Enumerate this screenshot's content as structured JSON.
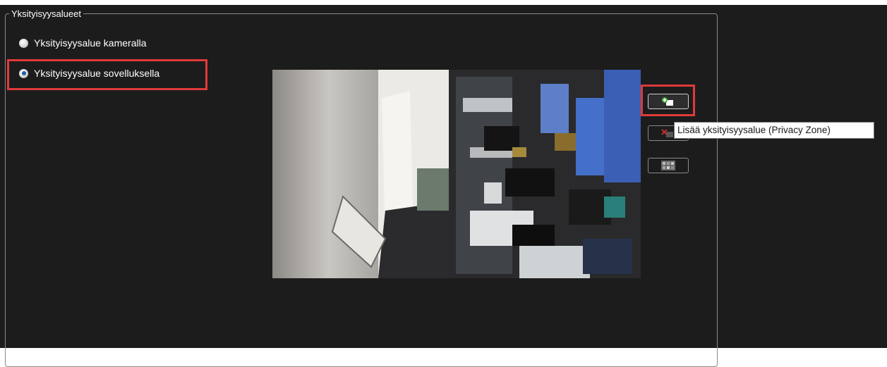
{
  "privacy_zones": {
    "title": "Yksityisyysalueet",
    "options": [
      {
        "label": "Yksityisyysalue kameralla",
        "checked": false
      },
      {
        "label": "Yksityisyysalue sovelluksella",
        "checked": true
      }
    ]
  },
  "toolbar": {
    "add_zone_icon": "add-privacy-zone-icon",
    "remove_zone_icon": "remove-privacy-zone-icon",
    "mosaic_icon": "mosaic-pattern-icon",
    "add_zone_tooltip": "Lisää yksityisyysalue (Privacy Zone)"
  },
  "colors": {
    "panel_bg": "#1c1c1c",
    "highlight": "#e03a3a",
    "text": "#ffffff",
    "selected_radio": "#1f5fa6"
  }
}
